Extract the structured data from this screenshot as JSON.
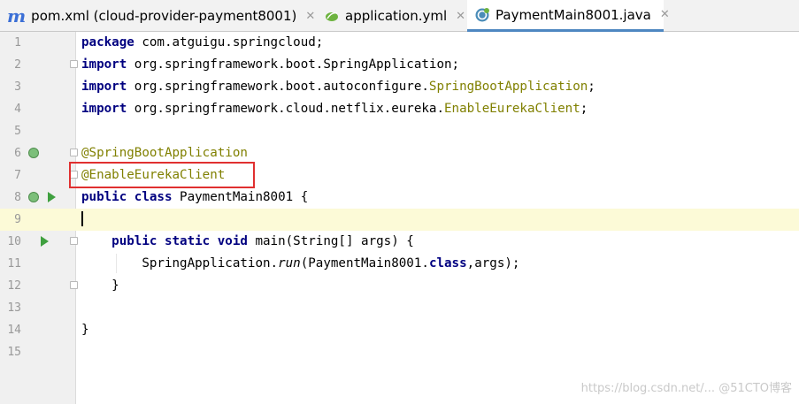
{
  "tabs": [
    {
      "label": "pom.xml (cloud-provider-payment8001)",
      "icon": "maven-m-icon",
      "icon_glyph": "m",
      "active": false
    },
    {
      "label": "application.yml",
      "icon": "spring-leaf-icon",
      "active": false
    },
    {
      "label": "PaymentMain8001.java",
      "icon": "spring-class-icon",
      "active": true
    }
  ],
  "close_glyph": "✕",
  "lines": [
    {
      "n": "1",
      "tokens": [
        {
          "t": "package",
          "c": "kw"
        },
        {
          "t": " com.atguigu.springcloud;"
        }
      ]
    },
    {
      "n": "2",
      "tokens": [
        {
          "t": "import",
          "c": "kw"
        },
        {
          "t": " org.springframework.boot.SpringApplication;"
        }
      ]
    },
    {
      "n": "3",
      "tokens": [
        {
          "t": "import",
          "c": "kw"
        },
        {
          "t": " org.springframework.boot.autoconfigure."
        },
        {
          "t": "SpringBootApplication",
          "c": "ann"
        },
        {
          "t": ";"
        }
      ]
    },
    {
      "n": "4",
      "tokens": [
        {
          "t": "import",
          "c": "kw"
        },
        {
          "t": " org.springframework.cloud.netflix.eureka."
        },
        {
          "t": "EnableEurekaClient",
          "c": "ann"
        },
        {
          "t": ";"
        }
      ]
    },
    {
      "n": "5",
      "tokens": []
    },
    {
      "n": "6",
      "tokens": [
        {
          "t": "@SpringBootApplication",
          "c": "ann"
        }
      ]
    },
    {
      "n": "7",
      "tokens": [
        {
          "t": "@EnableEurekaClient",
          "c": "ann"
        }
      ]
    },
    {
      "n": "8",
      "tokens": [
        {
          "t": "public",
          "c": "kw"
        },
        {
          "t": " "
        },
        {
          "t": "class",
          "c": "kw"
        },
        {
          "t": " PaymentMain8001 {"
        }
      ]
    },
    {
      "n": "9",
      "tokens": []
    },
    {
      "n": "10",
      "tokens": [
        {
          "t": "    "
        },
        {
          "t": "public",
          "c": "kw"
        },
        {
          "t": " "
        },
        {
          "t": "static",
          "c": "kw"
        },
        {
          "t": " "
        },
        {
          "t": "void",
          "c": "kw"
        },
        {
          "t": " main(String[] args) {"
        }
      ]
    },
    {
      "n": "11",
      "tokens": [
        {
          "t": "        SpringApplication."
        },
        {
          "t": "run",
          "c": "it"
        },
        {
          "t": "(PaymentMain8001."
        },
        {
          "t": "class",
          "c": "kw"
        },
        {
          "t": ",args);"
        }
      ]
    },
    {
      "n": "12",
      "tokens": [
        {
          "t": "    }"
        }
      ]
    },
    {
      "n": "13",
      "tokens": []
    },
    {
      "n": "14",
      "tokens": [
        {
          "t": "}"
        }
      ]
    },
    {
      "n": "15",
      "tokens": []
    }
  ],
  "current_line": "9",
  "watermark": "https://blog.csdn.net/... @51CTO博客"
}
